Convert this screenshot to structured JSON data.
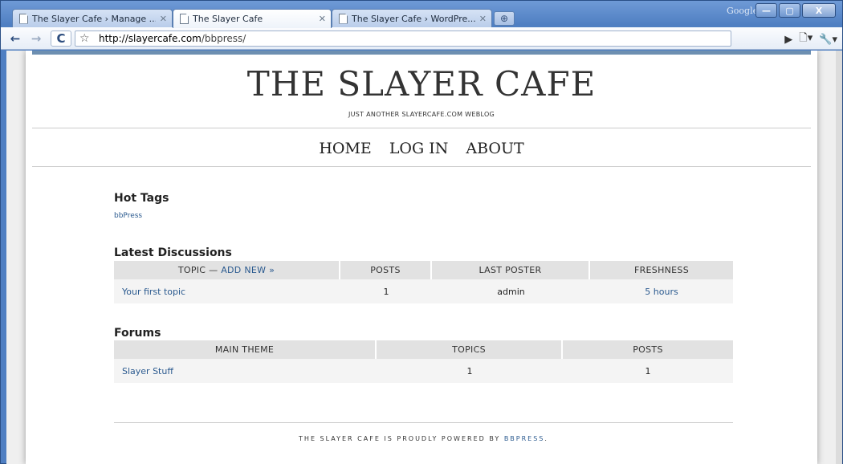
{
  "browser": {
    "tabs": [
      {
        "label": "The Slayer Cafe › Manage ..."
      },
      {
        "label": "The Slayer Cafe"
      },
      {
        "label": "The Slayer Cafe › WordPre..."
      }
    ],
    "google_label": "Google",
    "url_host": "http://slayercafe.com",
    "url_path": "/bbpress/"
  },
  "site": {
    "title": "THE SLAYER CAFE",
    "tagline": "JUST ANOTHER SLAYERCAFE.COM WEBLOG",
    "nav": [
      "HOME",
      "LOG IN",
      "ABOUT"
    ]
  },
  "hot_tags": {
    "title": "Hot Tags",
    "tags": [
      "bbPress"
    ]
  },
  "latest": {
    "title": "Latest Discussions",
    "headers": {
      "topic": "TOPIC —",
      "add_new": "ADD NEW »",
      "posts": "POSTS",
      "last_poster": "LAST POSTER",
      "freshness": "FRESHNESS"
    },
    "rows": [
      {
        "topic": "Your first topic",
        "posts": "1",
        "last_poster": "admin",
        "freshness": "5 hours"
      }
    ]
  },
  "forums": {
    "title": "Forums",
    "headers": {
      "main": "MAIN THEME",
      "topics": "TOPICS",
      "posts": "POSTS"
    },
    "rows": [
      {
        "name": "Slayer Stuff",
        "topics": "1",
        "posts": "1"
      }
    ]
  },
  "footer": {
    "text": "THE SLAYER CAFE IS PROUDLY POWERED BY",
    "link": "BBPRESS",
    "end": "."
  }
}
